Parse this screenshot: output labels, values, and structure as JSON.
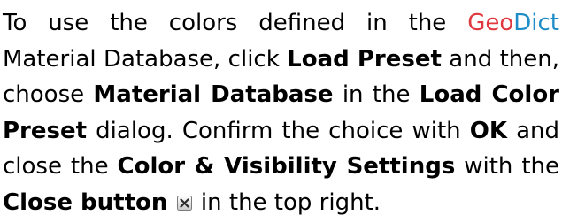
{
  "paragraph": {
    "t1": "To use the colors defined in the ",
    "brand_part1": "Geo",
    "brand_part2": "Dict",
    "t2": " Material Database, click ",
    "b1": "Load Preset",
    "t3": " and then, choose ",
    "b2": "Material Database",
    "t4": " in the ",
    "b3": "Load Color Preset",
    "t5": " dialog. Confirm the choice with ",
    "b4": "OK",
    "t6": " and close the ",
    "b5": "Color & Visibility Settings",
    "t7": " with the ",
    "b6": "Close button",
    "t8": " in the top right."
  },
  "icons": {
    "close_button_icon": "close-icon"
  },
  "colors": {
    "brand_geo": "#e0383f",
    "brand_dict": "#1d8cc7",
    "text": "#000000"
  }
}
